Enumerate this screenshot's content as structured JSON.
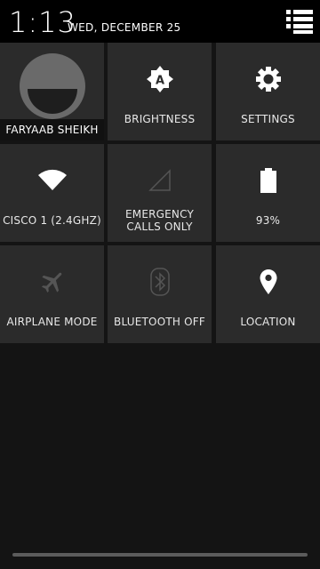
{
  "status": {
    "time": "1:13",
    "date": "WED, DECEMBER 25"
  },
  "tiles": {
    "user": {
      "name": "FARYAAB SHEIKH",
      "icon": "user-avatar-icon"
    },
    "brightness": {
      "label": "BRIGHTNESS",
      "icon": "brightness-auto-icon"
    },
    "settings": {
      "label": "SETTINGS",
      "icon": "gear-icon"
    },
    "wifi": {
      "label": "CISCO 1 (2.4GHZ)",
      "icon": "wifi-icon"
    },
    "mobile": {
      "label_line1": "EMERGENCY",
      "label_line2": "CALLS ONLY",
      "icon": "signal-icon"
    },
    "battery": {
      "label": "93%",
      "icon": "battery-icon",
      "level": 93
    },
    "airplane": {
      "label": "AIRPLANE MODE",
      "icon": "airplane-icon"
    },
    "bluetooth": {
      "label": "BLUETOOTH OFF",
      "icon": "bluetooth-icon"
    },
    "location": {
      "label": "LOCATION",
      "icon": "location-pin-icon"
    }
  },
  "colors": {
    "tile_bg": "#2b2b2b",
    "panel_bg": "#141414",
    "disabled_icon": "#555555",
    "active_icon": "#ffffff"
  }
}
